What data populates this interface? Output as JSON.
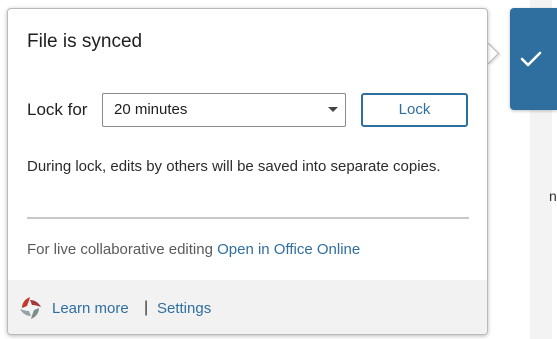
{
  "popup": {
    "title": "File is synced",
    "lock_label": "Lock for",
    "duration": {
      "selected": "20 minutes"
    },
    "lock_button": "Lock",
    "description": "During lock, edits by others will be saved into separate copies.",
    "collab_text": "For live collaborative editing ",
    "collab_link": "Open in Office Online",
    "footer": {
      "learn_more": "Learn more",
      "separator": "|",
      "settings": "Settings"
    }
  },
  "status_tab": {
    "icon": "checkmark-icon",
    "color": "#2f6fa0"
  },
  "background": {
    "fragment": "n"
  },
  "colors": {
    "accent": "#2f6fa0",
    "footer_bg": "#f2f2f2"
  }
}
